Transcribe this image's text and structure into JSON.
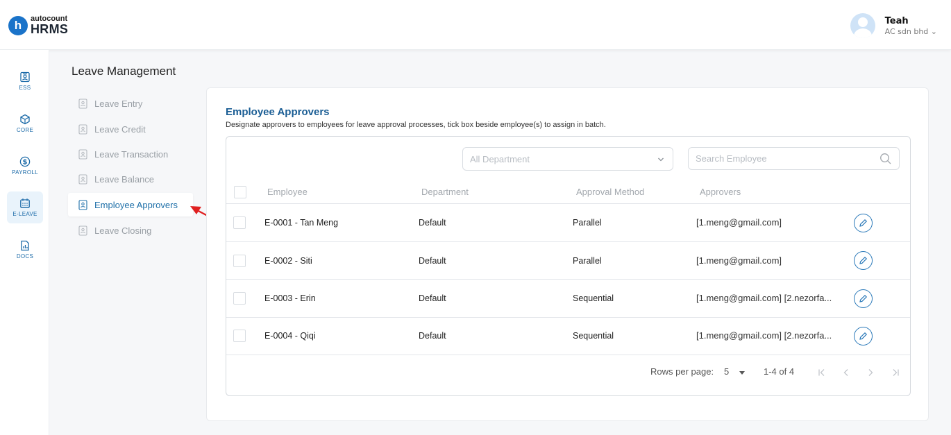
{
  "brand": {
    "top": "autocount",
    "bottom": "HRMS",
    "initial": "h",
    "color": "#1a73c9"
  },
  "user": {
    "name": "Teah",
    "company": "AC sdn bhd"
  },
  "rail": [
    {
      "label": "ESS",
      "icon": "id-card-icon",
      "active": false
    },
    {
      "label": "CORE",
      "icon": "cube-icon",
      "active": false
    },
    {
      "label": "PAYROLL",
      "icon": "dollar-circle-icon",
      "active": false
    },
    {
      "label": "E-LEAVE",
      "icon": "calendar-icon",
      "active": true
    },
    {
      "label": "DOCS",
      "icon": "document-chart-icon",
      "active": false
    }
  ],
  "section": {
    "title": "Leave Management"
  },
  "menu": [
    {
      "label": "Leave Entry",
      "active": false
    },
    {
      "label": "Leave Credit",
      "active": false
    },
    {
      "label": "Leave Transaction",
      "active": false
    },
    {
      "label": "Leave Balance",
      "active": false
    },
    {
      "label": "Employee Approvers",
      "active": true
    },
    {
      "label": "Leave Closing",
      "active": false
    }
  ],
  "card": {
    "title": "Employee Approvers",
    "description": "Designate approvers to employees for leave approval processes, tick box beside employee(s) to assign in batch."
  },
  "filters": {
    "department_placeholder": "All Department",
    "search_placeholder": "Search Employee"
  },
  "table": {
    "headers": {
      "employee": "Employee",
      "department": "Department",
      "method": "Approval Method",
      "approvers": "Approvers"
    },
    "rows": [
      {
        "employee": "E-0001 - Tan Meng",
        "department": "Default",
        "method": "Parallel",
        "approvers": "[1.meng@gmail.com]"
      },
      {
        "employee": "E-0002 - Siti",
        "department": "Default",
        "method": "Parallel",
        "approvers": "[1.meng@gmail.com]"
      },
      {
        "employee": "E-0003 - Erin",
        "department": "Default",
        "method": "Sequential",
        "approvers": "[1.meng@gmail.com] [2.nezorfa..."
      },
      {
        "employee": "E-0004 - Qiqi",
        "department": "Default",
        "method": "Sequential",
        "approvers": "[1.meng@gmail.com] [2.nezorfa..."
      }
    ]
  },
  "pagination": {
    "rows_label": "Rows per page:",
    "rows_value": "5",
    "range": "1-4 of 4"
  },
  "colors": {
    "accent": "#1e6fa8",
    "annotation_arrow": "#e02020"
  }
}
